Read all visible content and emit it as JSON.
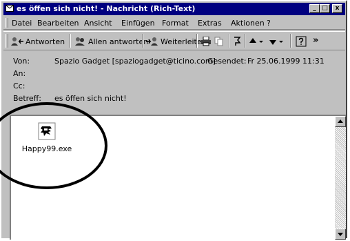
{
  "window": {
    "title": "es öffen sich nicht! - Nachricht (Rich-Text)",
    "minimize": "_",
    "maximize": "□",
    "close": "x"
  },
  "menu": [
    "Datei",
    "Bearbeiten",
    "Ansicht",
    "Einfügen",
    "Format",
    "Extras",
    "Aktionen",
    "?"
  ],
  "toolbar": {
    "reply": "Antworten",
    "reply_all": "Allen antworten",
    "forward": "Weiterleiten",
    "more": "»"
  },
  "header": {
    "from_label": "Von:",
    "from_value": "Spazio Gadget [spaziogadget@ticino.com]",
    "sent_label": "Gesendet:",
    "sent_value": "Fr 25.06.1999 11:31",
    "to_label": "An:",
    "cc_label": "Cc:",
    "subject_label": "Betreff:",
    "subject_value": "es öffen sich nicht!"
  },
  "attachment": {
    "filename": "Happy99.exe",
    "icon": "exe-file-icon"
  }
}
